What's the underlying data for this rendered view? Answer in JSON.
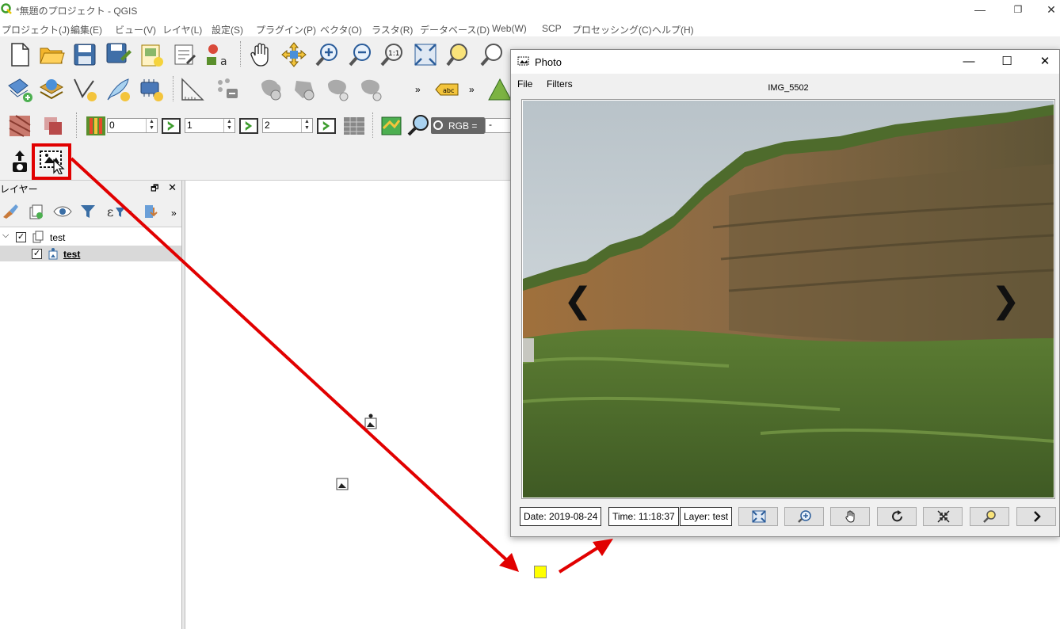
{
  "window": {
    "title": "*無題のプロジェクト - QGIS",
    "minimize": "—",
    "maximize": "❐",
    "close": "✕"
  },
  "menu": [
    "プロジェクト(J)",
    "編集(E)",
    "ビュー(V)",
    "レイヤ(L)",
    "設定(S)",
    "プラグイン(P)",
    "ベクタ(O)",
    "ラスタ(R)",
    "データベース(D)",
    "Web(W)",
    "SCP",
    "プロセッシング(C)",
    "ヘルプ(H)"
  ],
  "raster_toolbar": {
    "band_red": "0",
    "band_green": "1",
    "band_blue": "2",
    "rgb_label": "RGB =",
    "rgb_value": "-"
  },
  "layers_panel": {
    "title": "レイヤー",
    "float_btn": "🗗",
    "close_btn": "✕",
    "group": {
      "name": "test",
      "checked": "✓"
    },
    "layer": {
      "name": "test",
      "checked": "✓"
    }
  },
  "photo_window": {
    "title": "Photo",
    "menu_file": "File",
    "menu_filters": "Filters",
    "caption": "IMG_5502",
    "prev": "❮",
    "next": "❯",
    "date": "Date: 2019-08-24",
    "time": "Time: 11:18:37",
    "layer": "Layer: test",
    "minimize": "—",
    "maximize": "☐",
    "close": "✕"
  },
  "colors": {
    "annotation": "#e10000",
    "point": "#ffff00",
    "qgis_green": "#3c9c2c"
  }
}
